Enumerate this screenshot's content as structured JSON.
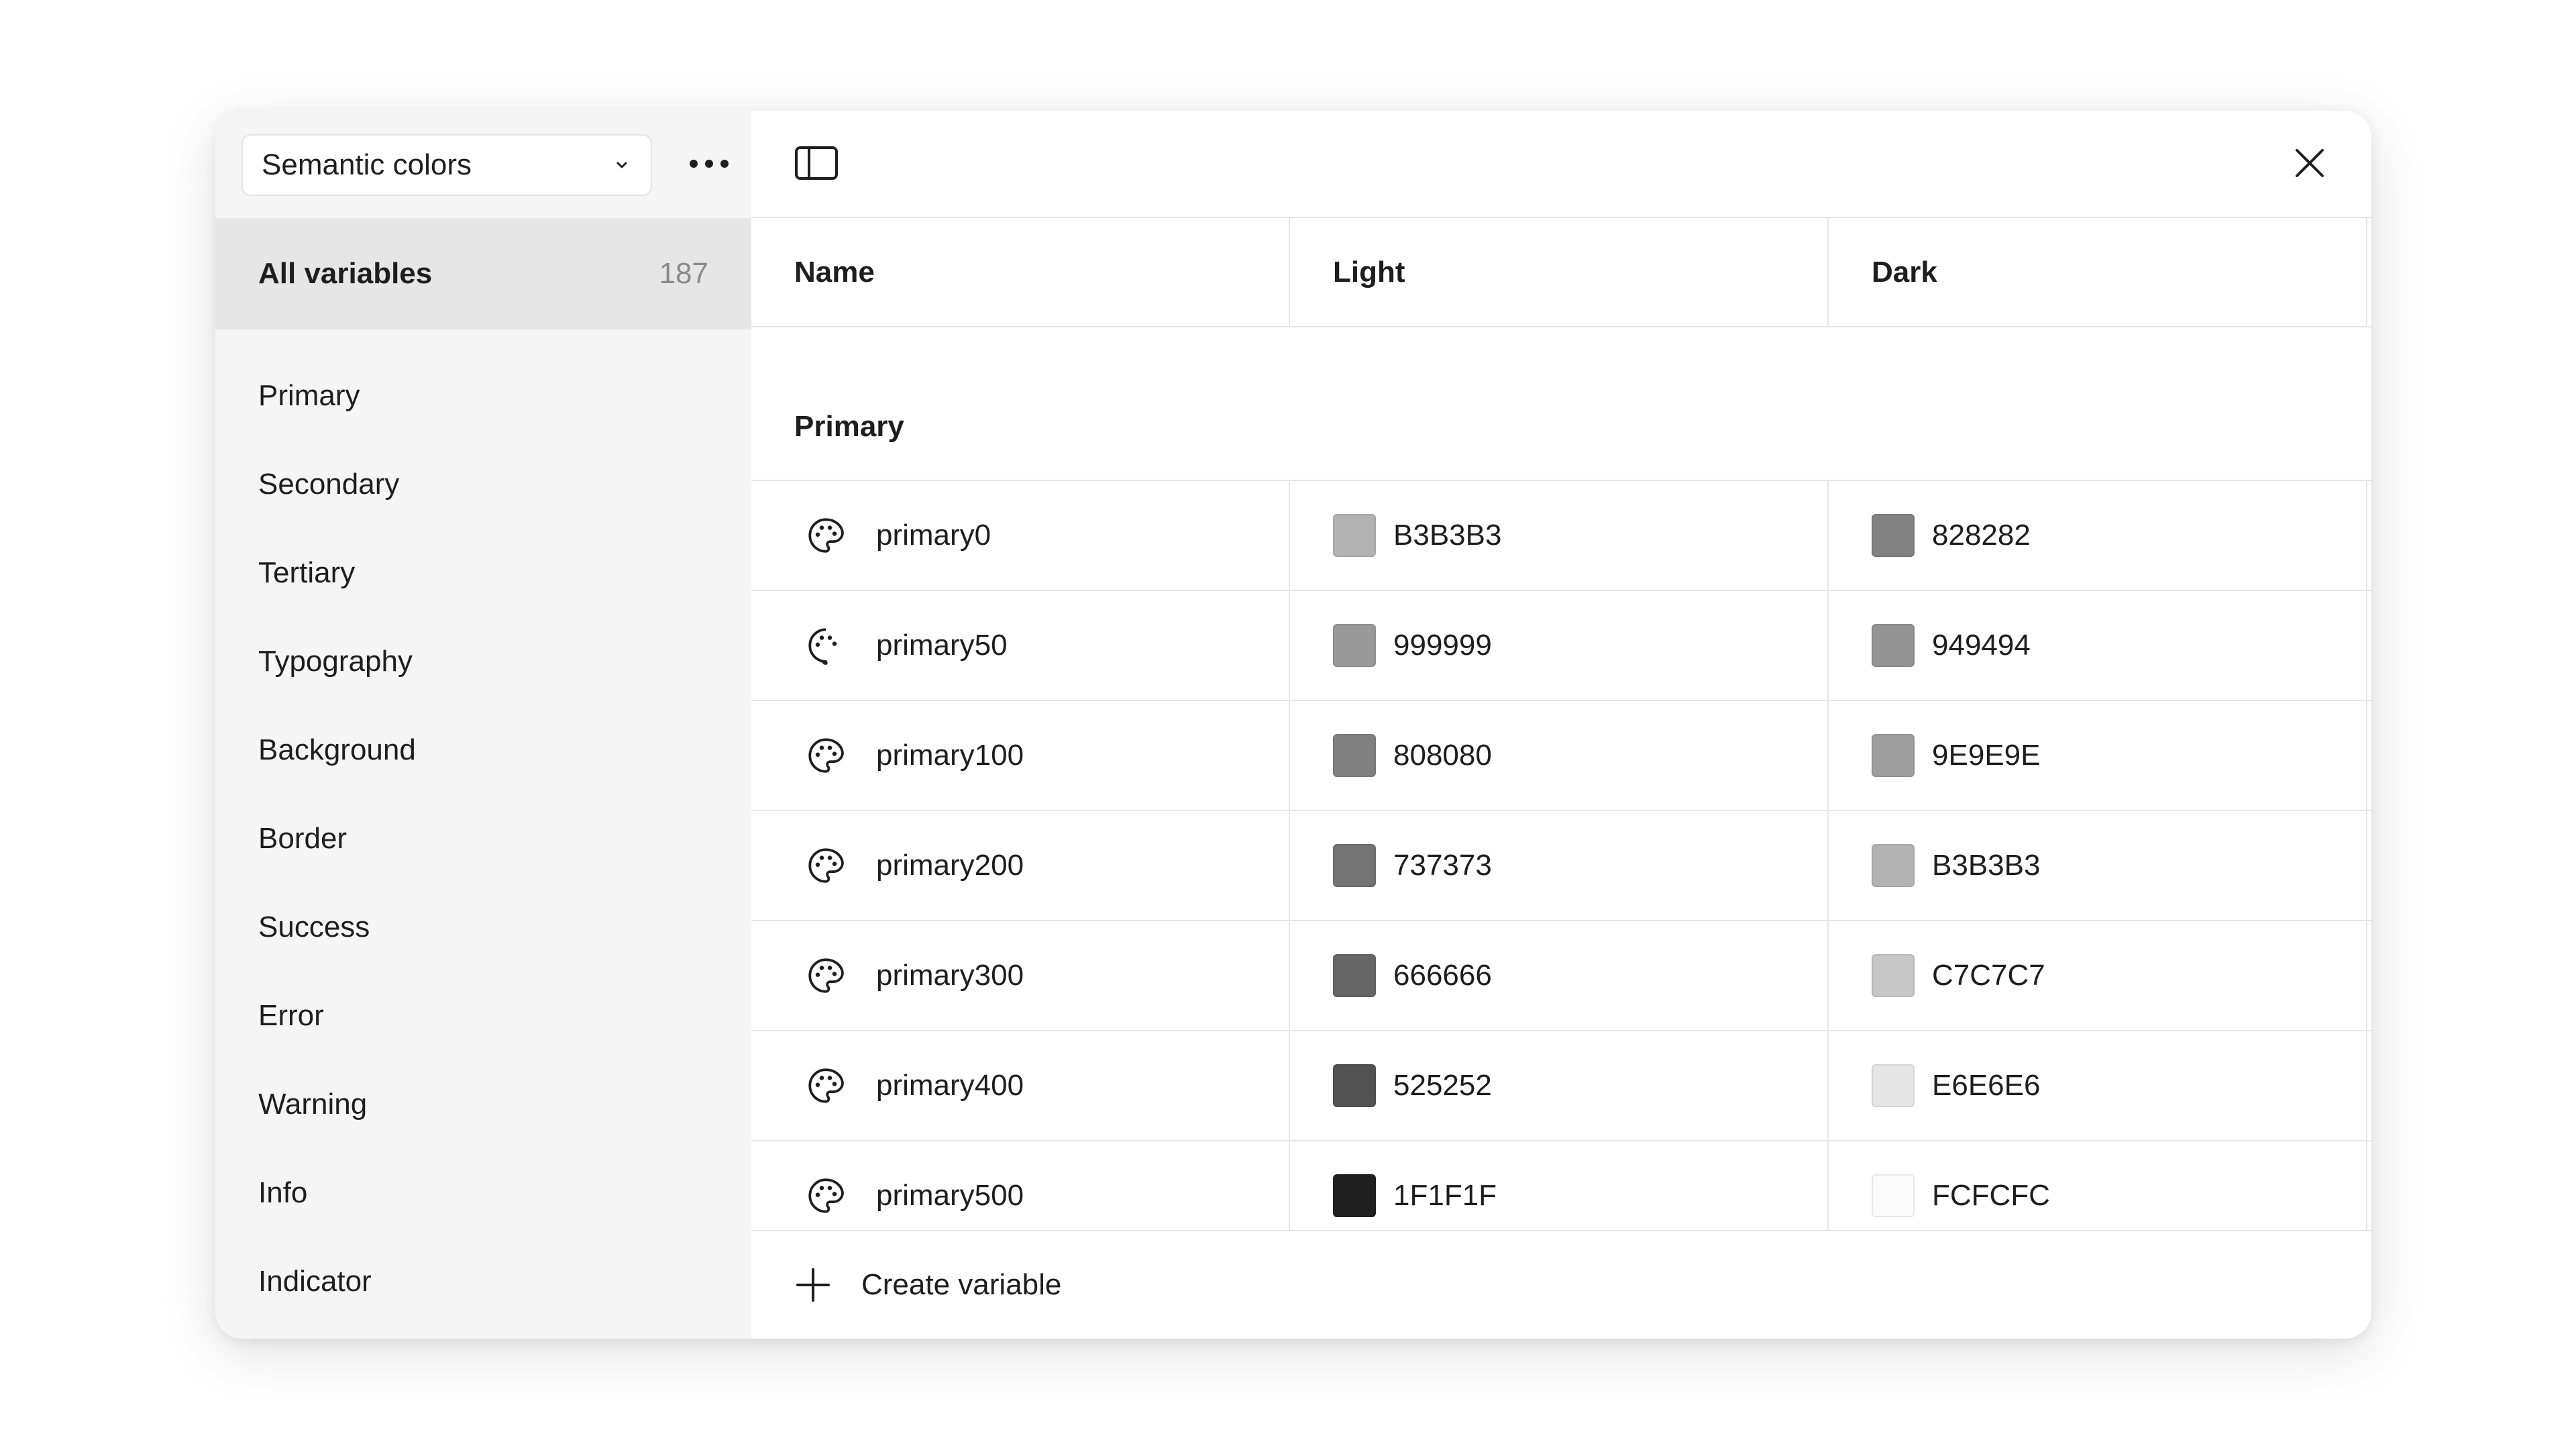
{
  "collection_select": {
    "label": "Semantic colors"
  },
  "all_variables": {
    "label": "All variables",
    "count": "187"
  },
  "groups": [
    {
      "label": "Primary"
    },
    {
      "label": "Secondary"
    },
    {
      "label": "Tertiary"
    },
    {
      "label": "Typography"
    },
    {
      "label": "Background"
    },
    {
      "label": "Border"
    },
    {
      "label": "Success"
    },
    {
      "label": "Error"
    },
    {
      "label": "Warning"
    },
    {
      "label": "Info"
    },
    {
      "label": "Indicator"
    }
  ],
  "table": {
    "columns": [
      "Name",
      "Light",
      "Dark"
    ],
    "group_title": "Primary",
    "rows": [
      {
        "name": "primary0",
        "light": "B3B3B3",
        "light_color": "#B3B3B3",
        "dark": "828282",
        "dark_color": "#828282"
      },
      {
        "name": "primary50",
        "light": "999999",
        "light_color": "#999999",
        "dark": "949494",
        "dark_color": "#949494"
      },
      {
        "name": "primary100",
        "light": "808080",
        "light_color": "#808080",
        "dark": "9E9E9E",
        "dark_color": "#9E9E9E"
      },
      {
        "name": "primary200",
        "light": "737373",
        "light_color": "#737373",
        "dark": "B3B3B3",
        "dark_color": "#B3B3B3"
      },
      {
        "name": "primary300",
        "light": "666666",
        "light_color": "#666666",
        "dark": "C7C7C7",
        "dark_color": "#C7C7C7"
      },
      {
        "name": "primary400",
        "light": "525252",
        "light_color": "#525252",
        "dark": "E6E6E6",
        "dark_color": "#E6E6E6"
      },
      {
        "name": "primary500",
        "light": "1F1F1F",
        "light_color": "#1F1F1F",
        "dark": "FCFCFC",
        "dark_color": "#FCFCFC"
      }
    ]
  },
  "create": {
    "label": "Create variable"
  },
  "icons": {
    "chevron": "chevron-down-icon",
    "more": "more-horizontal-icon",
    "sidebar_toggle": "sidebar-toggle-icon",
    "close": "close-icon",
    "palette": "palette-icon",
    "plus": "plus-icon"
  },
  "colors": {
    "sidebar_bg": "#F5F5F5",
    "selected_bg": "#E6E6E6",
    "divider": "#E6E6E6",
    "text": "#1E1E1E",
    "muted": "#8A8A8A"
  }
}
